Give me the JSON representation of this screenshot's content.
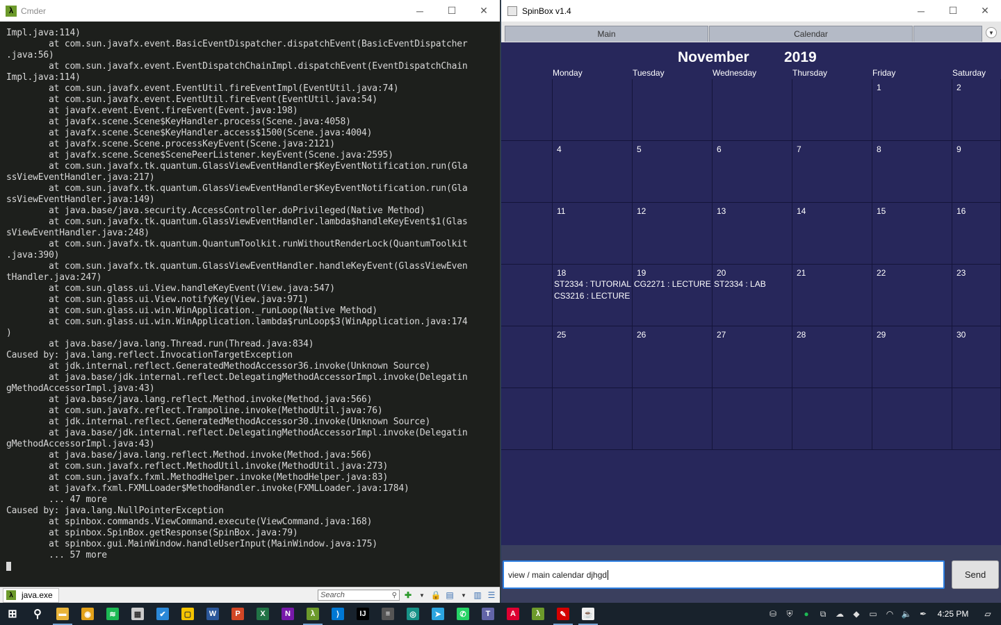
{
  "cmder": {
    "title": "Cmder",
    "lines": [
      "Impl.java:114)",
      "        at com.sun.javafx.event.BasicEventDispatcher.dispatchEvent(BasicEventDispatcher",
      ".java:56)",
      "        at com.sun.javafx.event.EventDispatchChainImpl.dispatchEvent(EventDispatchChain",
      "Impl.java:114)",
      "        at com.sun.javafx.event.EventUtil.fireEventImpl(EventUtil.java:74)",
      "        at com.sun.javafx.event.EventUtil.fireEvent(EventUtil.java:54)",
      "        at javafx.event.Event.fireEvent(Event.java:198)",
      "        at javafx.scene.Scene$KeyHandler.process(Scene.java:4058)",
      "        at javafx.scene.Scene$KeyHandler.access$1500(Scene.java:4004)",
      "        at javafx.scene.Scene.processKeyEvent(Scene.java:2121)",
      "        at javafx.scene.Scene$ScenePeerListener.keyEvent(Scene.java:2595)",
      "        at com.sun.javafx.tk.quantum.GlassViewEventHandler$KeyEventNotification.run(Gla",
      "ssViewEventHandler.java:217)",
      "        at com.sun.javafx.tk.quantum.GlassViewEventHandler$KeyEventNotification.run(Gla",
      "ssViewEventHandler.java:149)",
      "        at java.base/java.security.AccessController.doPrivileged(Native Method)",
      "        at com.sun.javafx.tk.quantum.GlassViewEventHandler.lambda$handleKeyEvent$1(Glas",
      "sViewEventHandler.java:248)",
      "        at com.sun.javafx.tk.quantum.QuantumToolkit.runWithoutRenderLock(QuantumToolkit",
      ".java:390)",
      "        at com.sun.javafx.tk.quantum.GlassViewEventHandler.handleKeyEvent(GlassViewEven",
      "tHandler.java:247)",
      "        at com.sun.glass.ui.View.handleKeyEvent(View.java:547)",
      "        at com.sun.glass.ui.View.notifyKey(View.java:971)",
      "        at com.sun.glass.ui.win.WinApplication._runLoop(Native Method)",
      "        at com.sun.glass.ui.win.WinApplication.lambda$runLoop$3(WinApplication.java:174",
      ")",
      "        at java.base/java.lang.Thread.run(Thread.java:834)",
      "Caused by: java.lang.reflect.InvocationTargetException",
      "        at jdk.internal.reflect.GeneratedMethodAccessor36.invoke(Unknown Source)",
      "        at java.base/jdk.internal.reflect.DelegatingMethodAccessorImpl.invoke(Delegatin",
      "gMethodAccessorImpl.java:43)",
      "        at java.base/java.lang.reflect.Method.invoke(Method.java:566)",
      "        at com.sun.javafx.reflect.Trampoline.invoke(MethodUtil.java:76)",
      "        at jdk.internal.reflect.GeneratedMethodAccessor30.invoke(Unknown Source)",
      "        at java.base/jdk.internal.reflect.DelegatingMethodAccessorImpl.invoke(Delegatin",
      "gMethodAccessorImpl.java:43)",
      "        at java.base/java.lang.reflect.Method.invoke(Method.java:566)",
      "        at com.sun.javafx.reflect.MethodUtil.invoke(MethodUtil.java:273)",
      "        at com.sun.javafx.fxml.MethodHelper.invoke(MethodHelper.java:83)",
      "        at javafx.fxml.FXMLLoader$MethodHandler.invoke(FXMLLoader.java:1784)",
      "        ... 47 more",
      "Caused by: java.lang.NullPointerException",
      "        at spinbox.commands.ViewCommand.execute(ViewCommand.java:168)",
      "        at spinbox.SpinBox.getResponse(SpinBox.java:79)",
      "        at spinbox.gui.MainWindow.handleUserInput(MainWindow.java:175)",
      "        ... 57 more"
    ],
    "status_tab_label": "java.exe",
    "search_placeholder": "Search"
  },
  "spinbox": {
    "title": "SpinBox v1.4",
    "tabs": [
      "Main",
      "Calendar"
    ],
    "calendar": {
      "month": "November",
      "year": "2019",
      "day_names": [
        "Monday",
        "Tuesday",
        "Wednesday",
        "Thursday",
        "Friday",
        "Saturday"
      ],
      "weeks": [
        [
          {
            "day": "",
            "events": []
          },
          {
            "day": "",
            "events": []
          },
          {
            "day": "",
            "events": []
          },
          {
            "day": "",
            "events": []
          },
          {
            "day": "1",
            "events": []
          },
          {
            "day": "2",
            "events": []
          }
        ],
        [
          {
            "day": "4",
            "events": []
          },
          {
            "day": "5",
            "events": []
          },
          {
            "day": "6",
            "events": []
          },
          {
            "day": "7",
            "events": []
          },
          {
            "day": "8",
            "events": []
          },
          {
            "day": "9",
            "events": []
          }
        ],
        [
          {
            "day": "11",
            "events": []
          },
          {
            "day": "12",
            "events": []
          },
          {
            "day": "13",
            "events": []
          },
          {
            "day": "14",
            "events": []
          },
          {
            "day": "15",
            "events": []
          },
          {
            "day": "16",
            "events": []
          }
        ],
        [
          {
            "day": "18",
            "events": [
              "ST2334 : TUTORIAL",
              "CS3216 : LECTURE"
            ]
          },
          {
            "day": "19",
            "events": [
              "CG2271 : LECTURE"
            ]
          },
          {
            "day": "20",
            "events": [
              "ST2334 : LAB"
            ]
          },
          {
            "day": "21",
            "events": []
          },
          {
            "day": "22",
            "events": []
          },
          {
            "day": "23",
            "events": []
          }
        ],
        [
          {
            "day": "25",
            "events": []
          },
          {
            "day": "26",
            "events": []
          },
          {
            "day": "27",
            "events": []
          },
          {
            "day": "28",
            "events": []
          },
          {
            "day": "29",
            "events": []
          },
          {
            "day": "30",
            "events": []
          }
        ],
        [
          {
            "day": "",
            "events": []
          },
          {
            "day": "",
            "events": []
          },
          {
            "day": "",
            "events": []
          },
          {
            "day": "",
            "events": []
          },
          {
            "day": "",
            "events": []
          },
          {
            "day": "",
            "events": []
          }
        ]
      ]
    },
    "input_value": "view / main calendar djhgd",
    "send_label": "Send"
  },
  "taskbar": {
    "apps": [
      {
        "name": "file-explorer-icon",
        "glyph": "▬",
        "color": "#e8b339"
      },
      {
        "name": "chrome-icon",
        "glyph": "◉",
        "color": "#e3a21a"
      },
      {
        "name": "spotify-icon",
        "glyph": "≋",
        "color": "#1db954"
      },
      {
        "name": "calendar-icon",
        "glyph": "▦",
        "color": "#cccccc"
      },
      {
        "name": "todo-icon",
        "glyph": "✔",
        "color": "#2b88d8"
      },
      {
        "name": "sticky-notes-icon",
        "glyph": "▢",
        "color": "#f5c400"
      },
      {
        "name": "word-icon",
        "glyph": "W",
        "color": "#2b579a"
      },
      {
        "name": "powerpoint-icon",
        "glyph": "P",
        "color": "#d24726"
      },
      {
        "name": "excel-icon",
        "glyph": "X",
        "color": "#217346"
      },
      {
        "name": "onenote-icon",
        "glyph": "N",
        "color": "#7719aa"
      },
      {
        "name": "cmder-icon",
        "glyph": "λ",
        "color": "#6c9a2b"
      },
      {
        "name": "vscode-icon",
        "glyph": "⟩",
        "color": "#0078d4"
      },
      {
        "name": "intellij-icon",
        "glyph": "IJ",
        "color": "#000000"
      },
      {
        "name": "app-icon",
        "glyph": "≡",
        "color": "#555555"
      },
      {
        "name": "gitkraken-icon",
        "glyph": "◎",
        "color": "#179287"
      },
      {
        "name": "telegram-icon",
        "glyph": "➤",
        "color": "#2ca5e0"
      },
      {
        "name": "whatsapp-icon",
        "glyph": "✆",
        "color": "#25d366"
      },
      {
        "name": "teams-icon",
        "glyph": "T",
        "color": "#6264a7"
      },
      {
        "name": "angular-icon",
        "glyph": "A",
        "color": "#dd0031"
      },
      {
        "name": "cmder-icon-2",
        "glyph": "λ",
        "color": "#6c9a2b"
      },
      {
        "name": "acrobat-icon",
        "glyph": "✎",
        "color": "#d40000"
      },
      {
        "name": "java-icon",
        "glyph": "☕",
        "color": "#f0f0f0"
      }
    ],
    "clock": "4:25 PM"
  }
}
